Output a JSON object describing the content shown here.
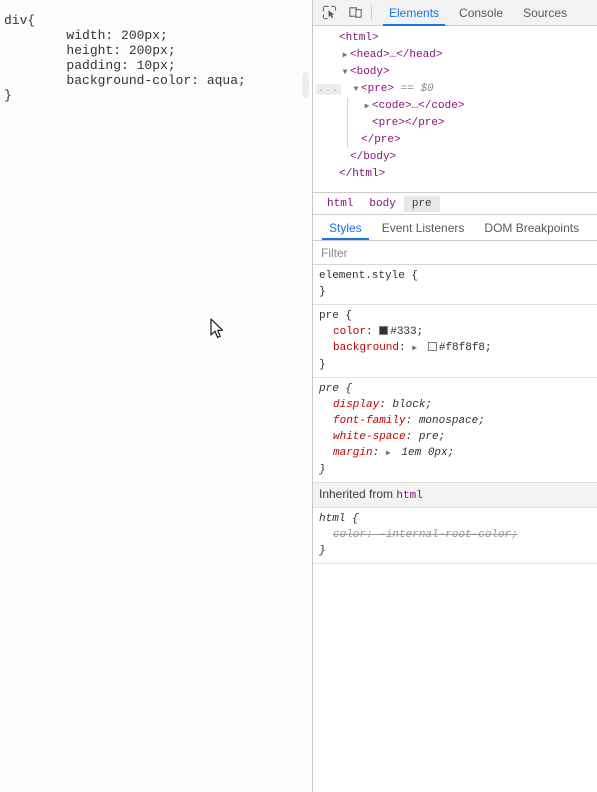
{
  "page": {
    "code": "div{\n        width: 200px;\n        height: 200px;\n        padding: 10px;\n        background-color: aqua;\n}",
    "cursor_icon": "arrow-cursor"
  },
  "devtools": {
    "toolbar": {
      "inspect_icon": "inspect-element-icon",
      "device_icon": "device-toolbar-icon",
      "tabs": [
        {
          "label": "Elements",
          "active": true
        },
        {
          "label": "Console",
          "active": false
        },
        {
          "label": "Sources",
          "active": false
        }
      ]
    },
    "dom_tree": [
      {
        "indent": 0,
        "twisty": "none",
        "text": "<html>",
        "badge": ""
      },
      {
        "indent": 1,
        "twisty": "collapsed",
        "text": "<head>…</head>",
        "badge": ""
      },
      {
        "indent": 1,
        "twisty": "expanded",
        "text": "<body>",
        "badge": ""
      },
      {
        "indent": 2,
        "twisty": "expanded",
        "text": "<pre>",
        "badge": "...",
        "selected_marker": " == $0"
      },
      {
        "indent": 3,
        "twisty": "collapsed",
        "text": "<code>…</code>",
        "badge": ""
      },
      {
        "indent": 3,
        "twisty": "none",
        "text": "<pre></pre>",
        "badge": ""
      },
      {
        "indent": 2,
        "twisty": "none",
        "text": "</pre>",
        "badge": ""
      },
      {
        "indent": 1,
        "twisty": "none",
        "text": "</body>",
        "badge": ""
      },
      {
        "indent": 0,
        "twisty": "none",
        "text": "</html>",
        "badge": ""
      }
    ],
    "breadcrumb": [
      {
        "label": "html",
        "active": false
      },
      {
        "label": "body",
        "active": false
      },
      {
        "label": "pre",
        "active": true
      }
    ],
    "style_tabs": [
      {
        "label": "Styles",
        "active": true
      },
      {
        "label": "Event Listeners",
        "active": false
      },
      {
        "label": "DOM Breakpoints",
        "active": false
      }
    ],
    "filter": {
      "placeholder": "Filter",
      "value": ""
    },
    "rules": [
      {
        "selector": "element.style",
        "user_agent": false,
        "declarations": []
      },
      {
        "selector": "pre",
        "user_agent": false,
        "declarations": [
          {
            "property": "color",
            "value": "#333",
            "swatch": "#333333",
            "expander": false,
            "inactive": false
          },
          {
            "property": "background",
            "value": "#f8f8f8",
            "swatch": "#f8f8f8",
            "expander": true,
            "inactive": false
          }
        ]
      },
      {
        "selector": "pre",
        "user_agent": true,
        "declarations": [
          {
            "property": "display",
            "value": "block",
            "swatch": "",
            "expander": false,
            "inactive": false
          },
          {
            "property": "font-family",
            "value": "monospace",
            "swatch": "",
            "expander": false,
            "inactive": false
          },
          {
            "property": "white-space",
            "value": "pre",
            "swatch": "",
            "expander": false,
            "inactive": false
          },
          {
            "property": "margin",
            "value": "1em 0px",
            "swatch": "",
            "expander": true,
            "inactive": false
          }
        ]
      }
    ],
    "inherited": {
      "header_prefix": "Inherited from ",
      "header_tag": "html",
      "rule": {
        "selector": "html",
        "user_agent": true,
        "declarations": [
          {
            "property": "color",
            "value": "-internal-root-color",
            "swatch": "",
            "expander": false,
            "inactive": true
          }
        ]
      }
    }
  },
  "colors": {
    "accent": "#1a73e8",
    "tag": "#881280",
    "property": "#c80000",
    "toolbar_bg": "#f3f3f3",
    "border": "#cdcdcd"
  }
}
